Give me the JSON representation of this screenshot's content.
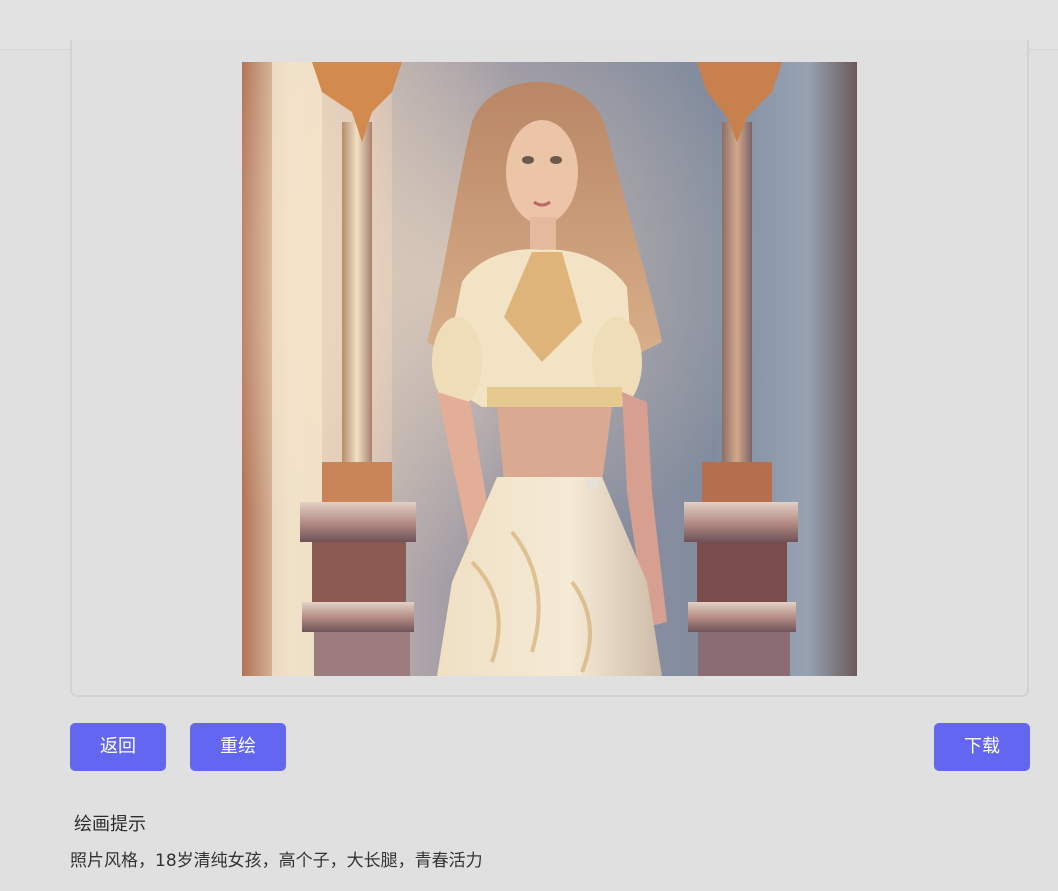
{
  "actions": {
    "back_label": "返回",
    "redraw_label": "重绘",
    "download_label": "下载"
  },
  "prompt": {
    "heading": "绘画提示",
    "text": "照片风格，18岁清纯女孩，高个子，大长腿，青春活力"
  },
  "colors": {
    "button": "#6366f0",
    "background": "#e0e0e0"
  },
  "icons": []
}
